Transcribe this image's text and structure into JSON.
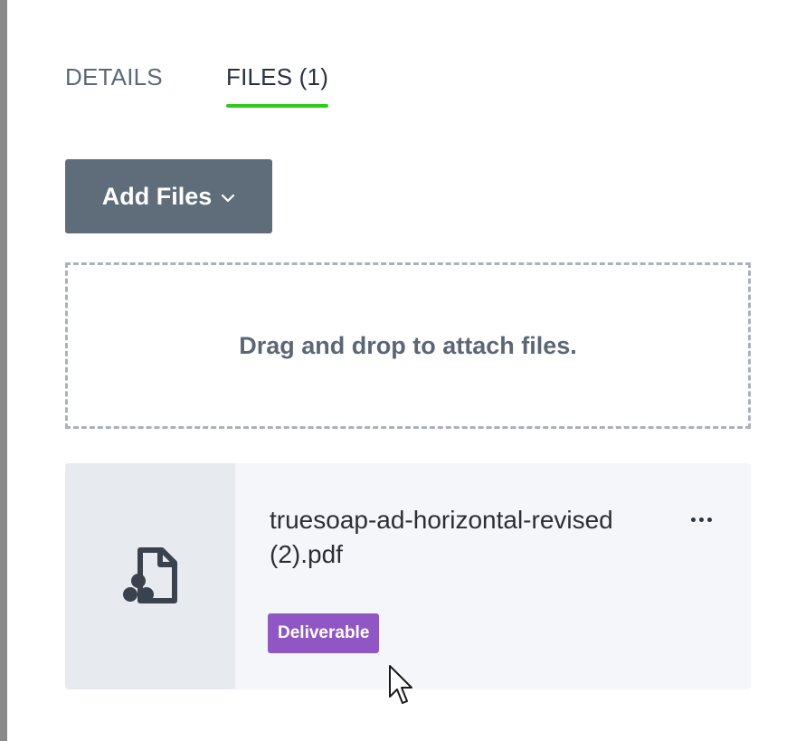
{
  "tabs": [
    {
      "label": "DETAILS",
      "active": false
    },
    {
      "label": "FILES (1)",
      "active": true
    }
  ],
  "colors": {
    "active_tab_underline": "#2ecc1a",
    "primary_button": "#5f6d7b",
    "tag_background": "#9057c4"
  },
  "add_files_button": {
    "label": "Add Files",
    "icon": "chevron-down-icon"
  },
  "dropzone": {
    "text": "Drag and drop to attach files."
  },
  "files": [
    {
      "name": "truesoap-ad-horizontal-revised (2).pdf",
      "icon": "pdf-file-icon",
      "tag": "Deliverable",
      "menu_icon": "more-horizontal-icon"
    }
  ]
}
